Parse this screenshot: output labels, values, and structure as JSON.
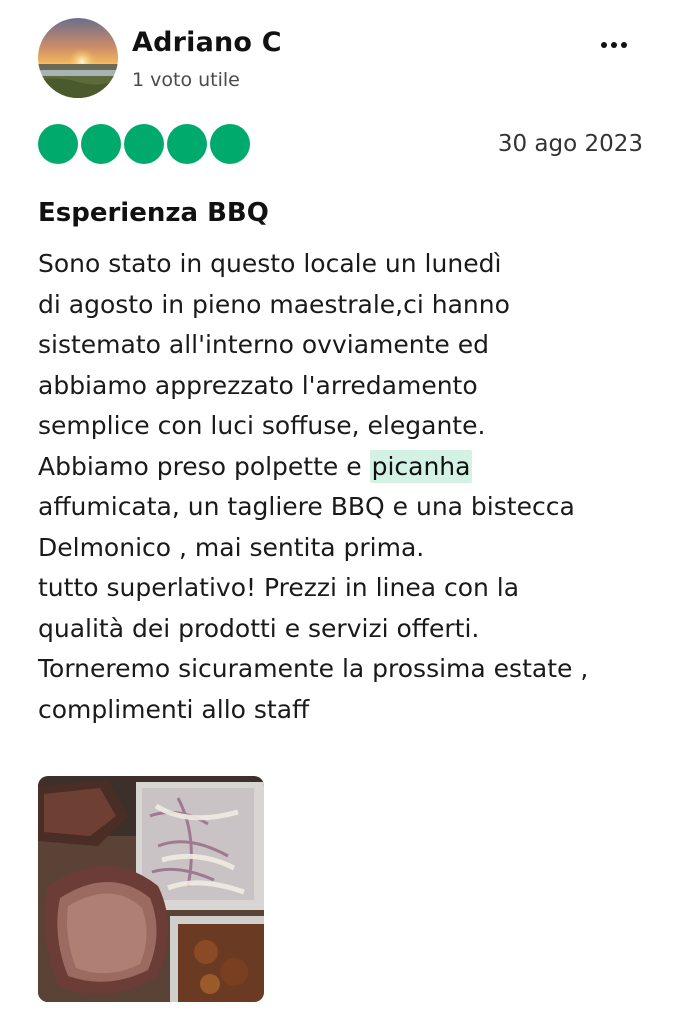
{
  "author": {
    "name": "Adriano C",
    "meta": "1 voto utile",
    "avatar_icon": "sunset-landscape-avatar"
  },
  "more_icon": "more-horizontal-icon",
  "rating": {
    "value": 5,
    "max": 5,
    "color": "#00aa6c"
  },
  "date": "30 ago 2023",
  "title": "Esperienza BBQ",
  "body": {
    "line1": "Sono stato in questo locale un lunedì",
    "line2": "di agosto in pieno maestrale,ci hanno",
    "line3": "sistemato all'interno ovviamente ed",
    "line4": "abbiamo apprezzato l'arredamento",
    "line5": "semplice con luci soffuse, elegante.",
    "line6_prefix": "Abbiamo preso polpette e ",
    "line6_highlight": "picanha",
    "line7": "affumicata, un tagliere BBQ e una bistecca",
    "line8": "Delmonico , mai sentita prima.",
    "line9": "tutto superlativo! Prezzi in linea con la",
    "line10": "qualità dei prodotti e servizi offerti.",
    "line11": "Torneremo sicuramente la prossima estate ,",
    "line12": "complimenti allo staff"
  },
  "highlight_color": "#d3f2e4",
  "photo": {
    "icon": "bbq-platter-photo"
  }
}
